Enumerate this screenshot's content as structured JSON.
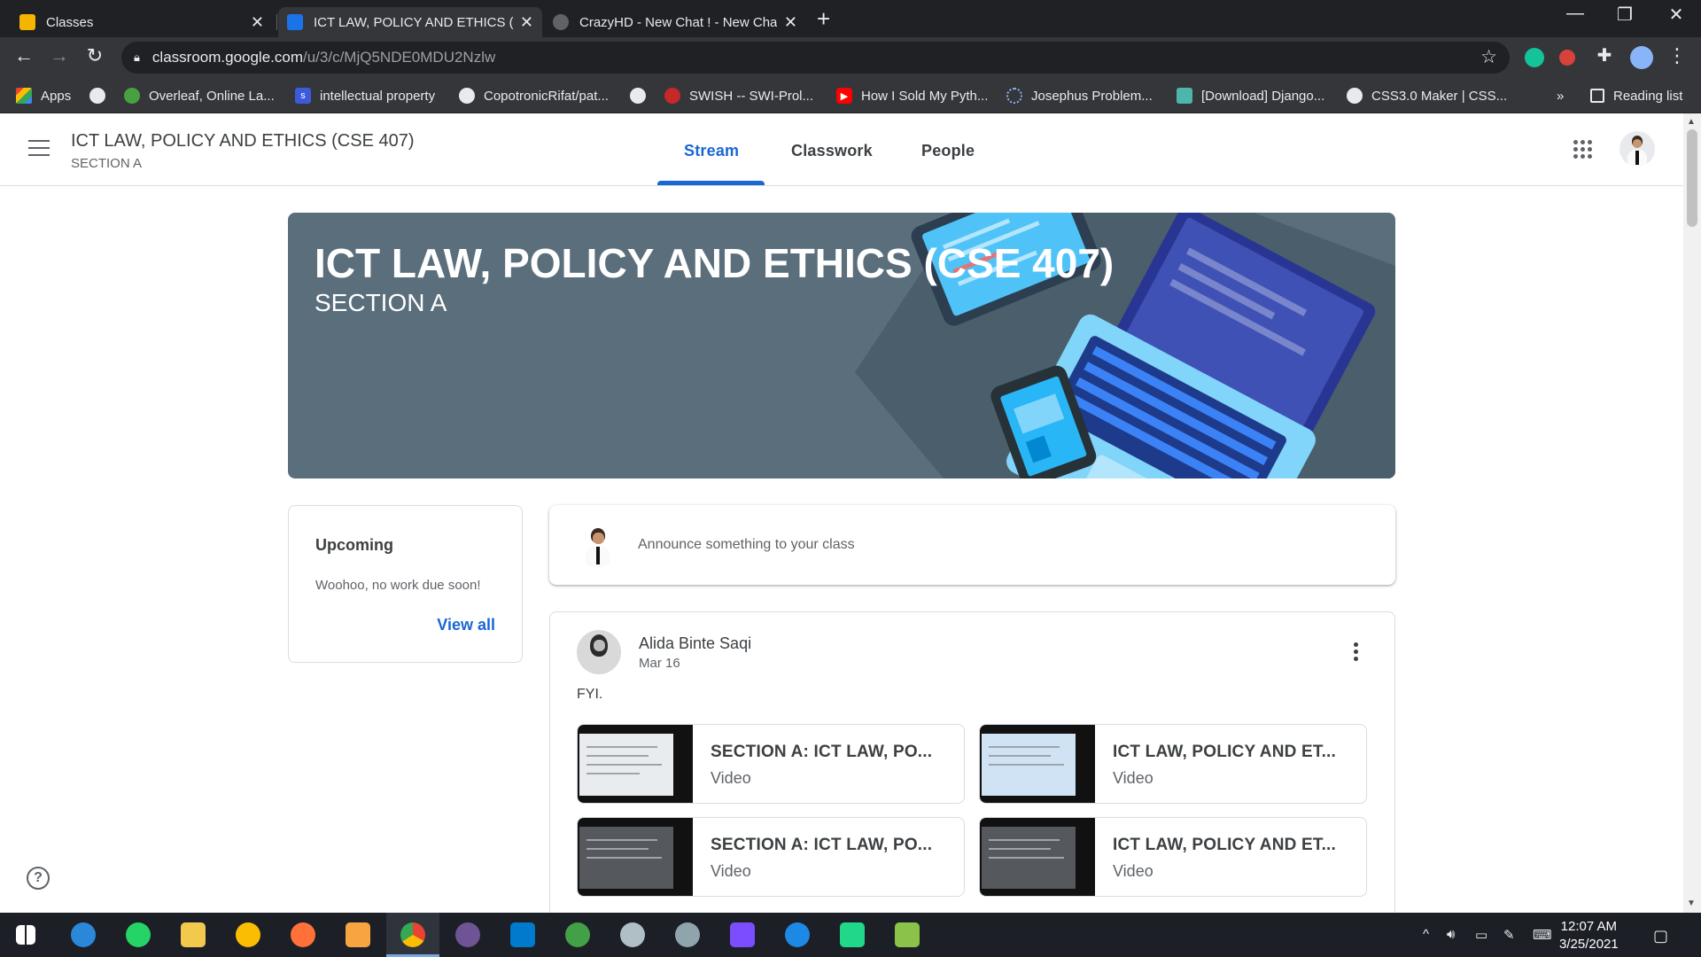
{
  "browser": {
    "tabs": [
      {
        "title": "Classes",
        "active": false
      },
      {
        "title": "ICT LAW, POLICY AND ETHICS (C",
        "active": true
      },
      {
        "title": "CrazyHD - New Chat ! - New Cha",
        "active": false
      }
    ],
    "url_host": "classroom.google.com",
    "url_path": "/u/3/c/MjQ5NDE0MDU2Nzlw",
    "bookmarks": [
      "Apps",
      "Overleaf, Online La...",
      "intellectual property",
      "CopotronicRifat/pat...",
      "SWISH -- SWI-Prol...",
      "How I Sold My Pyth...",
      "Josephus Problem...",
      "[Download] Django...",
      "CSS3.0 Maker | CSS..."
    ],
    "overflow_label": "»",
    "reading_list": "Reading list"
  },
  "classroom": {
    "class_title": "ICT LAW, POLICY AND ETHICS (CSE 407)",
    "section": "SECTION A",
    "nav_tabs": [
      "Stream",
      "Classwork",
      "People"
    ],
    "banner_title": "ICT LAW, POLICY AND ETHICS (CSE 407)",
    "banner_section": "SECTION A",
    "upcoming": {
      "heading": "Upcoming",
      "message": "Woohoo, no work due soon!",
      "view_all": "View all"
    },
    "announce_placeholder": "Announce something to your class",
    "post": {
      "author": "Alida Binte Saqi",
      "date": "Mar 16",
      "body": "FYI.",
      "attachments": [
        {
          "title": "SECTION A: ICT LAW, PO...",
          "type": "Video"
        },
        {
          "title": "ICT LAW, POLICY AND ET...",
          "type": "Video"
        },
        {
          "title": "SECTION A: ICT LAW, PO...",
          "type": "Video"
        },
        {
          "title": "ICT LAW, POLICY AND ET...",
          "type": "Video"
        }
      ]
    },
    "help_glyph": "?"
  },
  "taskbar": {
    "time": "12:07 AM",
    "date": "3/25/2021"
  },
  "colors": {
    "accent": "#1967d2",
    "banner": "#5a6e7c",
    "chrome_dark": "#202124",
    "chrome_toolbar": "#35363a"
  }
}
